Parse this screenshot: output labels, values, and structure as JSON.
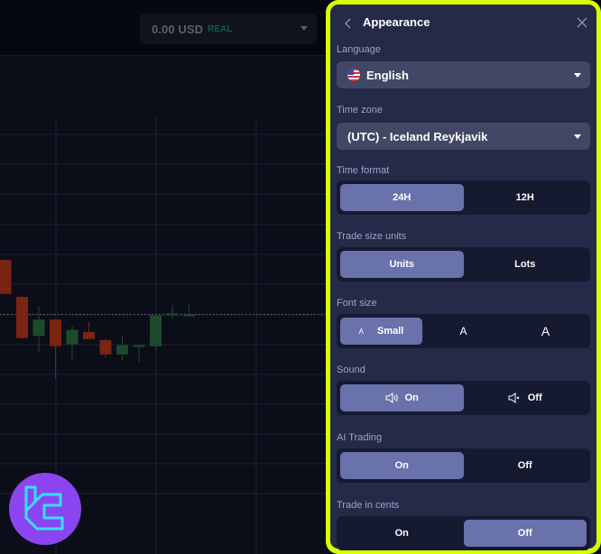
{
  "header": {
    "balance_amount": "0.00 USD",
    "account_type": "REAL"
  },
  "chart": {
    "type": "candlestick",
    "candles": [
      {
        "o": 100,
        "h": 100,
        "l": 66,
        "c": 67,
        "dir": "down"
      },
      {
        "o": 64,
        "h": 65,
        "l": 23,
        "c": 24,
        "dir": "down"
      },
      {
        "o": 26,
        "h": 55,
        "l": 10,
        "c": 42,
        "dir": "up"
      },
      {
        "o": 42,
        "h": 42,
        "l": -15,
        "c": 16,
        "dir": "down"
      },
      {
        "o": 18,
        "h": 36,
        "l": 3,
        "c": 32,
        "dir": "up"
      },
      {
        "o": 30,
        "h": 40,
        "l": 24,
        "c": 23,
        "dir": "down"
      },
      {
        "o": 22,
        "h": 24,
        "l": 5,
        "c": 8,
        "dir": "down"
      },
      {
        "o": 8,
        "h": 26,
        "l": 2,
        "c": 17,
        "dir": "up"
      },
      {
        "o": 16,
        "h": 18,
        "l": 1,
        "c": 17,
        "dir": "up"
      },
      {
        "o": 16,
        "h": 47,
        "l": 12,
        "c": 46,
        "dir": "up"
      },
      {
        "o": 46,
        "h": 56,
        "l": 43,
        "c": 48,
        "dir": "up"
      },
      {
        "o": 47,
        "h": 56,
        "l": 47,
        "c": 47,
        "dir": "up"
      }
    ],
    "current_price_level": 47,
    "colors": {
      "up": "#1d4a2a",
      "down": "#7a2412",
      "grid": "#1c2030",
      "price_line": "#6a6f7c"
    }
  },
  "logo": {
    "icon": "brand-logo-icon",
    "bg_color": "#8b45f0",
    "fg_color": "#33e0ff"
  },
  "panel": {
    "title": "Appearance",
    "accent": "#6a72ab",
    "frame_color": "#d9ff00",
    "language": {
      "label": "Language",
      "value": "English",
      "flag": "us-flag-icon"
    },
    "timezone": {
      "label": "Time zone",
      "value": "(UTC) - Iceland Reykjavik"
    },
    "time_format": {
      "label": "Time format",
      "options": [
        "24H",
        "12H"
      ],
      "selected": "24H"
    },
    "trade_size_units": {
      "label": "Trade size units",
      "options": [
        "Units",
        "Lots"
      ],
      "selected": "Units"
    },
    "font_size": {
      "label": "Font size",
      "options": [
        "Small",
        "A",
        "A"
      ],
      "selected": "Small",
      "small_glyph": "A"
    },
    "sound": {
      "label": "Sound",
      "options": [
        "On",
        "Off"
      ],
      "selected": "On"
    },
    "ai_trading": {
      "label": "AI Trading",
      "options": [
        "On",
        "Off"
      ],
      "selected": "On"
    },
    "trade_in_cents": {
      "label": "Trade in cents",
      "options": [
        "On",
        "Off"
      ],
      "selected": "Off"
    }
  }
}
